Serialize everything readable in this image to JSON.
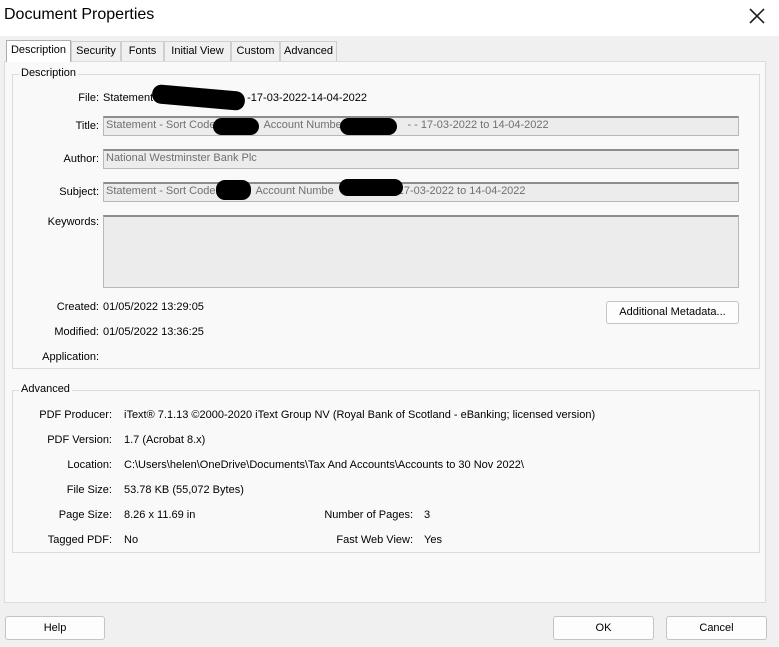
{
  "window": {
    "title": "Document Properties"
  },
  "tabs": [
    {
      "label": "Description"
    },
    {
      "label": "Security"
    },
    {
      "label": "Fonts"
    },
    {
      "label": "Initial View"
    },
    {
      "label": "Custom"
    },
    {
      "label": "Advanced"
    }
  ],
  "description": {
    "legend": "Description",
    "file_label": "File:",
    "file_prefix": "Statement",
    "file_suffix": "-17-03-2022-14-04-2022",
    "title_label": "Title:",
    "title_part1": "Statement - Sort Code",
    "title_part2": "Account Number",
    "title_part3": "- - 17-03-2022 to 14-04-2022",
    "author_label": "Author:",
    "author_value": "National Westminster Bank Plc",
    "subject_label": "Subject:",
    "subject_part1": "Statement - Sort Code",
    "subject_part2": "Account Numbe",
    "subject_part3": "17-03-2022 to 14-04-2022",
    "keywords_label": "Keywords:",
    "keywords_value": "",
    "created_label": "Created:",
    "created_value": "01/05/2022 13:29:05",
    "modified_label": "Modified:",
    "modified_value": "01/05/2022 13:36:25",
    "application_label": "Application:",
    "application_value": "",
    "metadata_button": "Additional Metadata..."
  },
  "advanced": {
    "legend": "Advanced",
    "producer_label": "PDF Producer:",
    "producer_value": "iText® 7.1.13 ©2000-2020 iText Group NV (Royal Bank of Scotland - eBanking; licensed version)",
    "version_label": "PDF Version:",
    "version_value": "1.7 (Acrobat 8.x)",
    "location_label": "Location:",
    "location_value": "C:\\Users\\helen\\OneDrive\\Documents\\Tax And Accounts\\Accounts to 30 Nov 2022\\",
    "filesize_label": "File Size:",
    "filesize_value": "53.78 KB (55,072 Bytes)",
    "pagesize_label": "Page Size:",
    "pagesize_value": "8.26 x 11.69 in",
    "pages_label": "Number of Pages:",
    "pages_value": "3",
    "tagged_label": "Tagged PDF:",
    "tagged_value": "No",
    "fastweb_label": "Fast Web View:",
    "fastweb_value": "Yes"
  },
  "footer": {
    "help": "Help",
    "ok": "OK",
    "cancel": "Cancel"
  }
}
